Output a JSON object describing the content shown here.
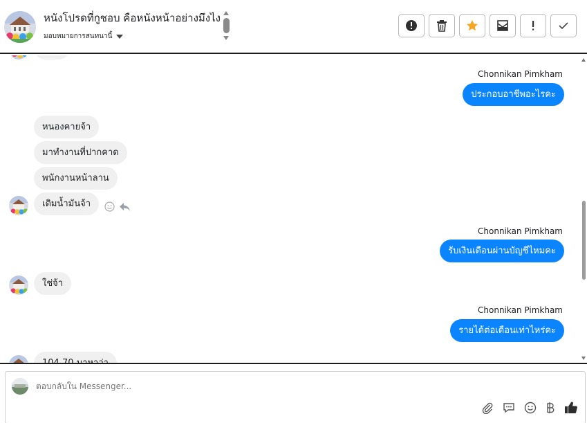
{
  "header": {
    "page_title": "หนังโปรดที่กูชอบ คือหนังหน้าอย่างมึงไง",
    "assign_label": "มอบหมายการสนทนานี้"
  },
  "toolbar": {
    "buttons": [
      {
        "name": "mark-spam-button",
        "icon": "alert-circle-icon"
      },
      {
        "name": "delete-button",
        "icon": "trash-icon"
      },
      {
        "name": "star-button",
        "icon": "star-icon",
        "color": "#f5a623"
      },
      {
        "name": "mark-unread-button",
        "icon": "mail-icon"
      },
      {
        "name": "follow-up-button",
        "icon": "exclamation-icon"
      },
      {
        "name": "done-button",
        "icon": "check-icon"
      }
    ]
  },
  "messages": {
    "sender_name": "Chonnikan Pimkham",
    "out_1": "ประกอบอาชีพอะไรคะ",
    "in_1": "หนองคายจ้า",
    "in_2": "มาทำงานที่ปากคาด",
    "in_3": "พนักงานหน้าลาน",
    "in_4": "เติมน้ำมันจ้า",
    "out_2": "รับเงินเดือนผ่านบัญชีไหมคะ",
    "in_5": "ใช่จ้า",
    "out_3": "รายได้ต่อเดือนเท่าไหร่คะ",
    "in_6_partial": "104.70 มาหาว่า"
  },
  "composer": {
    "placeholder": "ตอบกลับใน Messenger..."
  },
  "colors": {
    "outgoing_bubble": "#0b84ff",
    "incoming_bubble": "#f0f0f0",
    "star": "#f5a623"
  }
}
